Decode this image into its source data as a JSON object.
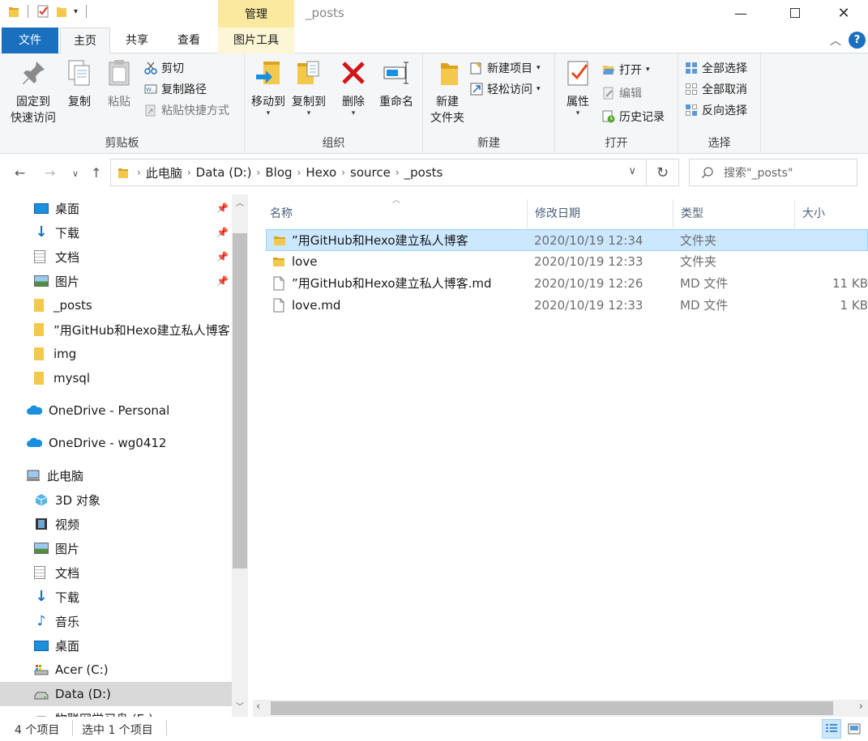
{
  "window": {
    "title": "_posts",
    "context_tab": "管理",
    "minimize_icon": "minimize-icon",
    "maximize_icon": "maximize-icon",
    "close_icon": "close-icon"
  },
  "ribbon_tabs": {
    "file": "文件",
    "home": "主页",
    "share": "共享",
    "view": "查看",
    "picture_tools": "图片工具"
  },
  "ribbon": {
    "clipboard": {
      "label": "剪贴板",
      "pin_quick": "固定到\n快速访问",
      "copy": "复制",
      "paste": "粘贴",
      "cut": "剪切",
      "copy_path": "复制路径",
      "paste_shortcut": "粘贴快捷方式"
    },
    "organize": {
      "label": "组织",
      "move_to": "移动到",
      "copy_to": "复制到",
      "delete": "删除",
      "rename": "重命名"
    },
    "new": {
      "label": "新建",
      "new_folder": "新建\n文件夹",
      "new_item": "新建项目",
      "easy_access": "轻松访问"
    },
    "open": {
      "label": "打开",
      "properties": "属性",
      "open": "打开",
      "edit": "编辑",
      "history": "历史记录"
    },
    "select": {
      "label": "选择",
      "select_all": "全部选择",
      "select_none": "全部取消",
      "invert": "反向选择"
    }
  },
  "address": {
    "crumbs": [
      "此电脑",
      "Data (D:)",
      "Blog",
      "Hexo",
      "source",
      "_posts"
    ],
    "search_placeholder": "搜索\"_posts\""
  },
  "nav": {
    "items": [
      {
        "label": "桌面",
        "icon": "desktop-icon",
        "pinned": true
      },
      {
        "label": "下载",
        "icon": "download-icon",
        "pinned": true
      },
      {
        "label": "文档",
        "icon": "document-icon",
        "pinned": true
      },
      {
        "label": "图片",
        "icon": "picture-icon",
        "pinned": true
      },
      {
        "label": "_posts",
        "icon": "folder-icon"
      },
      {
        "label": "”用GitHub和Hexo建立私人博客",
        "icon": "folder-icon"
      },
      {
        "label": "img",
        "icon": "folder-icon"
      },
      {
        "label": "mysql",
        "icon": "folder-icon"
      },
      {
        "label": "OneDrive - Personal",
        "icon": "onedrive-icon"
      },
      {
        "label": "OneDrive - wg0412",
        "icon": "onedrive-icon"
      },
      {
        "label": "此电脑",
        "icon": "computer-icon"
      },
      {
        "label": "3D 对象",
        "icon": "3d-objects-icon"
      },
      {
        "label": "视频",
        "icon": "video-icon"
      },
      {
        "label": "图片",
        "icon": "picture-icon"
      },
      {
        "label": "文档",
        "icon": "document-icon"
      },
      {
        "label": "下载",
        "icon": "download-icon"
      },
      {
        "label": "音乐",
        "icon": "music-icon"
      },
      {
        "label": "桌面",
        "icon": "desktop-icon"
      },
      {
        "label": "Acer (C:)",
        "icon": "drive-icon"
      },
      {
        "label": "Data (D:)",
        "icon": "drive-icon",
        "selected": true
      },
      {
        "label": "物联网学习盘 (E:)",
        "icon": "drive-icon"
      }
    ]
  },
  "columns": {
    "name": "名称",
    "date": "修改日期",
    "type": "类型",
    "size": "大小"
  },
  "files": [
    {
      "name": "”用GitHub和Hexo建立私人博客",
      "date": "2020/10/19 12:34",
      "type": "文件夹",
      "size": "",
      "icon": "folder-icon",
      "selected": true
    },
    {
      "name": "love",
      "date": "2020/10/19 12:33",
      "type": "文件夹",
      "size": "",
      "icon": "folder-icon"
    },
    {
      "name": "”用GitHub和Hexo建立私人博客.md",
      "date": "2020/10/19 12:26",
      "type": "MD 文件",
      "size": "11 KB",
      "icon": "file-icon"
    },
    {
      "name": "love.md",
      "date": "2020/10/19 12:33",
      "type": "MD 文件",
      "size": "1 KB",
      "icon": "file-icon"
    }
  ],
  "status": {
    "count": "4 个项目",
    "selected": "选中 1 个项目"
  },
  "colors": {
    "accent": "#1a6fbf",
    "selection": "#cce8ff",
    "context_tab": "#fbe9a0",
    "folder": "#f4c84a"
  }
}
